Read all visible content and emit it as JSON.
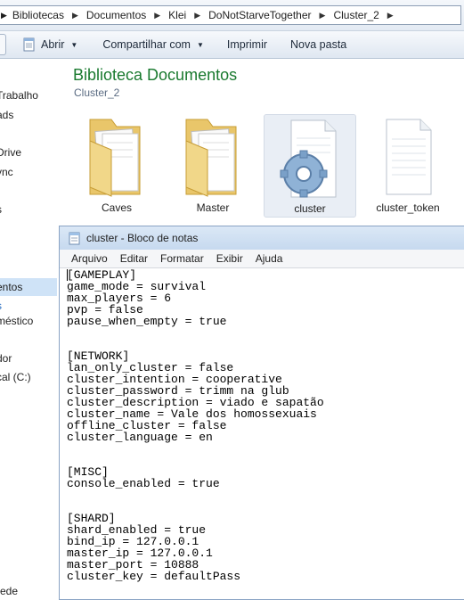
{
  "address_bar": {
    "path": [
      "Bibliotecas",
      "Documentos",
      "Klei",
      "DoNotStarveTogether",
      "Cluster_2"
    ]
  },
  "toolbar": {
    "open_label": "Abrir",
    "share_label": "Compartilhar com",
    "print_label": "Imprimir",
    "new_folder_label": "Nova pasta"
  },
  "nav_pane": {
    "items": [
      {
        "label": "Trabalho"
      },
      {
        "label": "ads"
      },
      {
        "label": "Drive"
      },
      {
        "label": "ync"
      },
      {
        "label": "s"
      },
      {
        "label": "entos",
        "selected": true
      },
      {
        "label": "s"
      },
      {
        "label": "méstico"
      },
      {
        "label": "dor"
      },
      {
        "label": "cal (C:)"
      },
      {
        "label": "rede"
      }
    ]
  },
  "library": {
    "title": "Biblioteca Documentos",
    "subtitle": "Cluster_2",
    "files": [
      {
        "name": "Caves",
        "kind": "folder-icon"
      },
      {
        "name": "Master",
        "kind": "folder-icon"
      },
      {
        "name": "cluster",
        "kind": "settings-file-icon",
        "selected": true
      },
      {
        "name": "cluster_token",
        "kind": "text-file-icon"
      }
    ]
  },
  "notepad": {
    "title": "cluster - Bloco de notas",
    "menu": [
      "Arquivo",
      "Editar",
      "Formatar",
      "Exibir",
      "Ajuda"
    ],
    "lines": [
      "[GAMEPLAY]",
      "game_mode = survival",
      "max_players = 6",
      "pvp = false",
      "pause_when_empty = true",
      "",
      "",
      "[NETWORK]",
      "lan_only_cluster = false",
      "cluster_intention = cooperative",
      "cluster_password = trimm na glub",
      "cluster_description = viado e sapatão",
      "cluster_name = Vale dos homossexuais",
      "offline_cluster = false",
      "cluster_language = en",
      "",
      "",
      "[MISC]",
      "console_enabled = true",
      "",
      "",
      "[SHARD]",
      "shard_enabled = true",
      "bind_ip = 127.0.0.1",
      "master_ip = 127.0.0.1",
      "master_port = 10888",
      "cluster_key = defaultPass"
    ]
  },
  "colors": {
    "library_title": "#1a7a2f",
    "selection": "#cfe3f7",
    "window_border": "#8aa3c4"
  }
}
